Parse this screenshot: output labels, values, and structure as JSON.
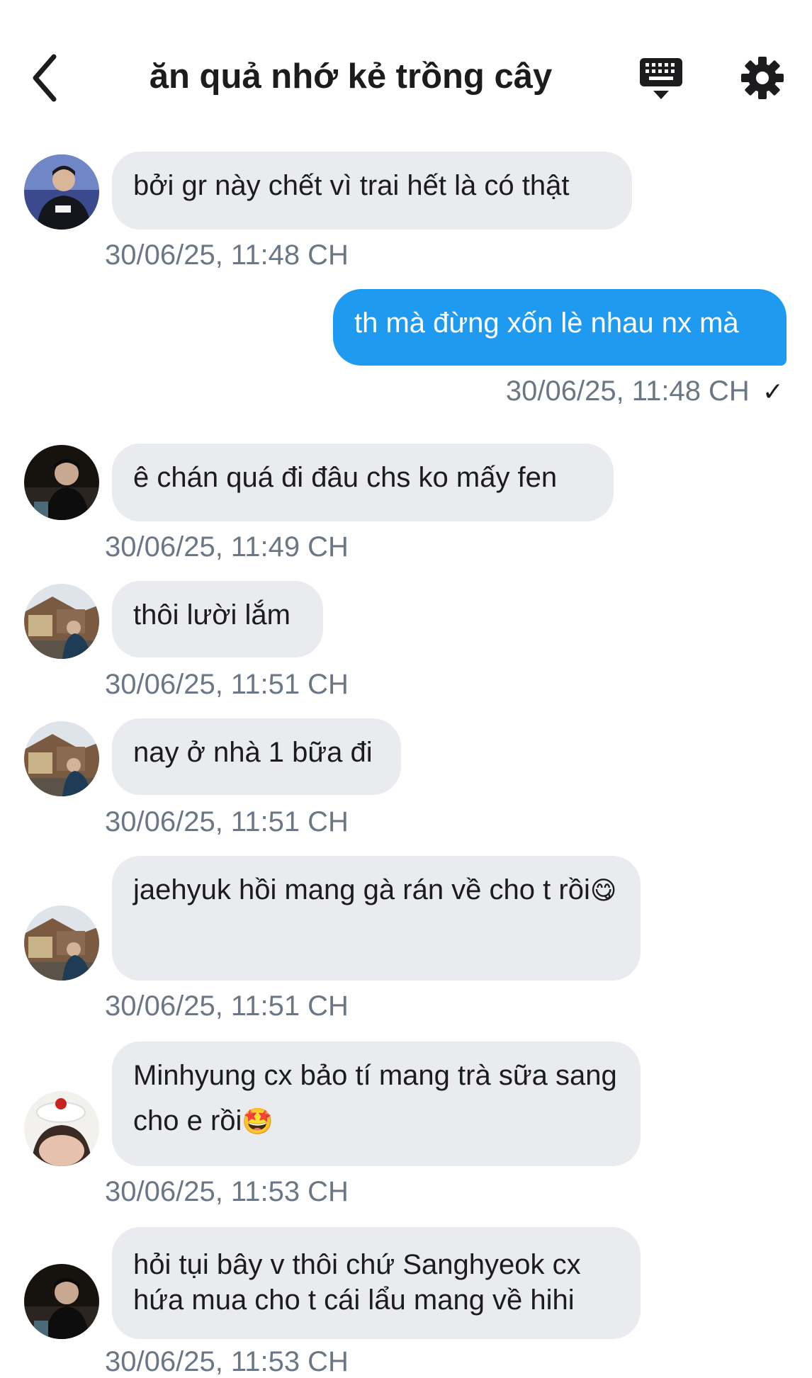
{
  "header": {
    "title": "ăn quả nhớ kẻ trồng cây",
    "back_icon": "chevron-left-icon",
    "keyboard_icon": "keyboard-icon",
    "settings_icon": "gear-icon"
  },
  "colors": {
    "outgoing_bubble": "#1e9bf0",
    "incoming_bubble": "#e9ebef",
    "timestamp": "#6b7785"
  },
  "messages": [
    {
      "direction": "in",
      "text": "bởi gr này chết vì trai hết là có thật",
      "time": "30/06/25, 11:48 CH"
    },
    {
      "direction": "out",
      "text": "th mà đừng xốn lè nhau nx mà",
      "time": "30/06/25, 11:48 CH",
      "status": "✓"
    },
    {
      "direction": "in",
      "text": "ê chán quá đi đâu chs ko mấy fen",
      "time": "30/06/25, 11:49 CH"
    },
    {
      "direction": "in",
      "text": "thôi lười lắm",
      "time": "30/06/25, 11:51 CH"
    },
    {
      "direction": "in",
      "text": "nay ở nhà 1 bữa đi",
      "time": "30/06/25, 11:51 CH"
    },
    {
      "direction": "in",
      "text": "jaehyuk hồi mang gà rán về cho t rồi",
      "emoji": "😋",
      "time": "30/06/25, 11:51 CH"
    },
    {
      "direction": "in",
      "text": "Minhyung cx bảo tí mang trà sữa sang cho e rồi",
      "emoji": "🤩",
      "time": "30/06/25, 11:53 CH"
    },
    {
      "direction": "in",
      "text": "hỏi tụi bây v thôi chứ Sanghyeok cx hứa mua cho t cái lẩu mang về hihi",
      "time": "30/06/25, 11:53 CH"
    }
  ]
}
